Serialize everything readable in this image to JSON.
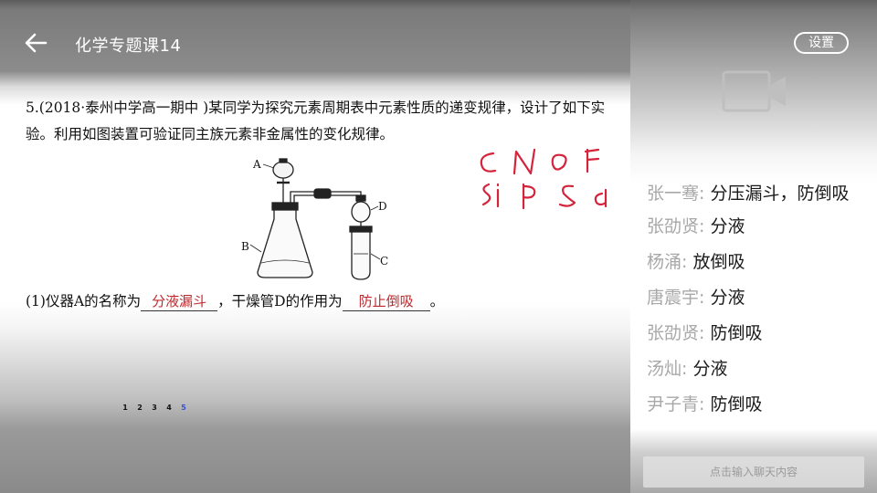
{
  "header": {
    "title": "化学专题课14"
  },
  "question": {
    "stem": "5.(2018·泰州中学高一期中 )某同学为探究元素周期表中元素性质的递变规律，设计了如下实验。利用如图装置可验证同主族元素非金属性的变化规律。",
    "part1_prefix": "(1)仪器A的名称为",
    "answer_a": "分液漏斗",
    "part1_middle": "，干燥管D的作用为",
    "answer_b": "防止倒吸",
    "part1_suffix": "。",
    "labels": {
      "a": "A",
      "b": "B",
      "c": "C",
      "d": "D"
    }
  },
  "pager": {
    "pages": [
      "1",
      "2",
      "3",
      "4",
      "5"
    ],
    "current": "5"
  },
  "panel": {
    "settings_label": "设置",
    "input_placeholder": "点击输入聊天内容",
    "messages": [
      {
        "user": "张一骞:",
        "text": "分压漏斗，防倒吸"
      },
      {
        "user": "张劭贤:",
        "text": "分液"
      },
      {
        "user": "杨涌:",
        "text": "放倒吸"
      },
      {
        "user": "唐震宇:",
        "text": "分液"
      },
      {
        "user": "张劭贤:",
        "text": "防倒吸"
      },
      {
        "user": "汤灿:",
        "text": "分液"
      },
      {
        "user": "尹子青:",
        "text": "防倒吸"
      }
    ]
  },
  "colors": {
    "answer": "#c0282d",
    "ink": "#d4233b",
    "active_page": "#3a4fd0"
  }
}
